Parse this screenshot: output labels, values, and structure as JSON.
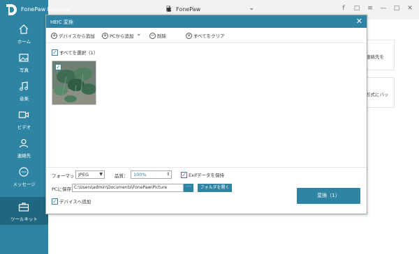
{
  "app": {
    "name": "FonePaw DoTrans",
    "brand_color": "#2d84a3"
  },
  "device": {
    "name": "FonePaw",
    "icon": "apple-icon"
  },
  "window_controls": [
    "facebook-icon",
    "chat-icon",
    "menu-icon",
    "minimize-icon",
    "maximize-icon",
    "close-icon"
  ],
  "sidebar": {
    "items": [
      {
        "label": "ホーム",
        "icon": "home-icon"
      },
      {
        "label": "写真",
        "icon": "photo-icon"
      },
      {
        "label": "音楽",
        "icon": "music-icon"
      },
      {
        "label": "ビデオ",
        "icon": "video-icon"
      },
      {
        "label": "連絡先",
        "icon": "contacts-icon"
      },
      {
        "label": "メッセージ",
        "icon": "message-icon"
      },
      {
        "label": "ツールキット",
        "icon": "toolkit-icon",
        "active": true
      }
    ]
  },
  "background": {
    "card1_text": "連絡先を",
    "card2_text": "形式にバッ"
  },
  "dialog": {
    "title": "HEIC 変換",
    "toolbar": {
      "add_from_device": "デバイスから追加",
      "add_from_pc": "PCから追加",
      "delete": "削除",
      "clear_all": "すべてをクリア"
    },
    "select_all": {
      "label": "すべてを選択（1）",
      "checked": true
    },
    "photos": [
      {
        "checked": true
      }
    ],
    "format": {
      "label": "フォーマット：",
      "value": "JPEG"
    },
    "quality": {
      "label": "品質：",
      "value": "100%"
    },
    "keep_exif": {
      "label": "Exifデータを保持",
      "checked": true
    },
    "pc_save": {
      "label": "PCに保存：",
      "path": "C:\\Users\\admin\\Documents\\FonePaw\\Picture",
      "browse": "···",
      "open_folder": "フォルダを開く"
    },
    "add_to_device": {
      "label": "デバイスへ追加",
      "checked": true
    },
    "convert_button": "変換（1）"
  }
}
